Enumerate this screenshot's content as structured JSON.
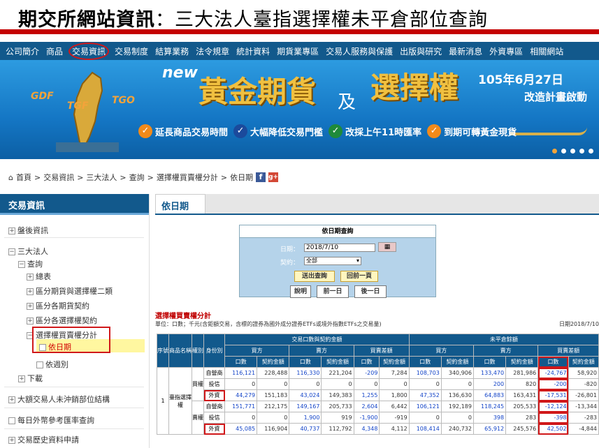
{
  "slide": {
    "title_bold": "期交所網站資訊",
    "title_rest": "：三大法人臺指選擇權未平倉部位查詢"
  },
  "topnav": [
    "公司簡介",
    "商品",
    "交易資訊",
    "交易制度",
    "結算業務",
    "法令規章",
    "統計資料",
    "期貨業專區",
    "交易人服務與保護",
    "出版與研究",
    "最新消息",
    "外資專區",
    "相關網站"
  ],
  "banner": {
    "new": "new",
    "gold": "黃金期貨",
    "ji": "及",
    "options": "選擇權",
    "date": "105年6月27日",
    "sub": "改造計畫啟動",
    "badges": [
      "GDF",
      "TGF",
      "TGO"
    ],
    "features": [
      "延長商品交易時間",
      "大幅降低交易門檻",
      "改採上午11時匯率",
      "到期可轉黃金現貨"
    ],
    "check": "✓"
  },
  "breadcrumb": [
    "首頁",
    "交易資訊",
    "三大法人",
    "查詢",
    "選擇權買賣權分計",
    "依日期"
  ],
  "breadcrumb_sep": ">",
  "social": {
    "fb": "f",
    "gplus": "g+"
  },
  "sidebar": {
    "header": "交易資訊",
    "items": [
      "盤後資訊",
      "三大法人",
      "查詢",
      "總表",
      "區分期貨與選擇權二類",
      "區分各期貨契約",
      "區分各選擇權契約",
      "選擇權買賣權分計",
      "依日期",
      "依週別",
      "下載",
      "大額交易人未沖銷部位結構",
      "每日外幣參考匯率查詢",
      "交易歷史資料申請"
    ],
    "plus": "+",
    "minus": "−"
  },
  "main": {
    "tab": "依日期",
    "query": {
      "title": "依日期查詢",
      "date_label": "日期：",
      "date_value": "2018/7/10",
      "contract_label": "契約：",
      "contract_value": "全部",
      "btn_query": "送出查詢",
      "btn_prev_page": "回前一頁",
      "btn_help": "說明",
      "btn_prev_day": "前一日",
      "btn_next_day": "後一日"
    },
    "section_title": "選擇權買賣權分計",
    "unit_text": "單位：口數；千元(含鉅額交易，含標的證券為國外成分證券ETFs或境外指數ETFs之交易量)",
    "date_text": "日期2018/7/10",
    "table": {
      "group_headers": [
        "交易口數與契約金額",
        "未平倉餘額"
      ],
      "sub_headers": [
        "買方",
        "賣方",
        "買賣差額",
        "買方",
        "賣方",
        "買賣差額"
      ],
      "left_headers": [
        "序號",
        "商品名稱",
        "權別",
        "身份別"
      ],
      "col_headers": [
        "口數",
        "契約金額",
        "口數",
        "契約金額",
        "口數",
        "契約金額",
        "口數",
        "契約金額",
        "口數",
        "契約金額",
        "口數",
        "契約金額"
      ],
      "seq": "1",
      "product": "臺指選擇權",
      "rights": [
        "買權",
        "賣權"
      ],
      "roles": [
        "自營商",
        "投信",
        "外資"
      ],
      "rows": [
        [
          "116,121",
          "228,488",
          "116,330",
          "221,204",
          "-209",
          "7,284",
          "108,703",
          "340,906",
          "133,470",
          "281,986",
          "-24,767",
          "58,920"
        ],
        [
          "0",
          "0",
          "0",
          "0",
          "0",
          "0",
          "0",
          "0",
          "200",
          "820",
          "-200",
          "-820"
        ],
        [
          "44,279",
          "151,183",
          "43,024",
          "149,383",
          "1,255",
          "1,800",
          "47,352",
          "136,630",
          "64,883",
          "163,431",
          "-17,531",
          "-26,801"
        ],
        [
          "151,771",
          "212,175",
          "149,167",
          "205,733",
          "2,604",
          "6,442",
          "106,121",
          "192,189",
          "118,245",
          "205,533",
          "-12,124",
          "-13,344"
        ],
        [
          "0",
          "0",
          "1,900",
          "919",
          "-1,900",
          "-919",
          "0",
          "0",
          "398",
          "283",
          "-398",
          "-283"
        ],
        [
          "45,085",
          "116,904",
          "40,737",
          "112,792",
          "4,348",
          "4,112",
          "108,414",
          "240,732",
          "65,912",
          "245,576",
          "42,502",
          "-4,844"
        ]
      ]
    }
  }
}
